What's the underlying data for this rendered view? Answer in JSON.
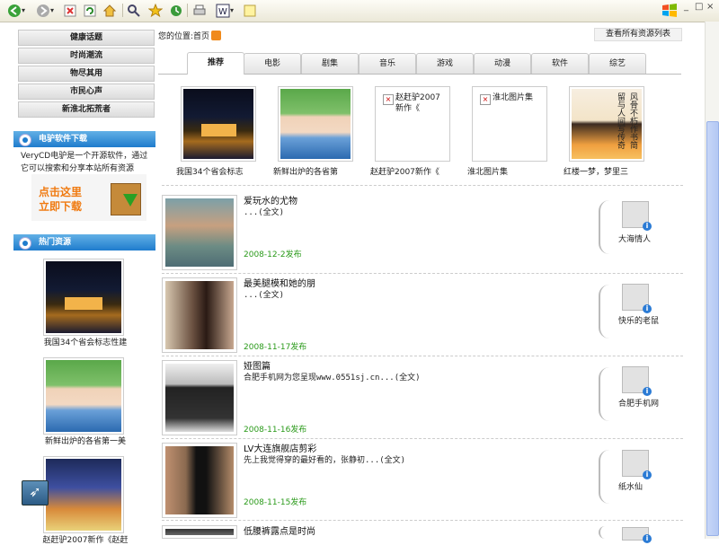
{
  "toolbar": {
    "icons": [
      "back-icon",
      "forward-icon",
      "stop-icon",
      "refresh-icon",
      "home-icon",
      "search-icon",
      "favorites-icon",
      "history-icon",
      "print-icon",
      "word-icon",
      "note-icon"
    ],
    "windows": [
      "_",
      "□",
      "×"
    ]
  },
  "sidebar": {
    "links": [
      "健康话题",
      "时尚潮流",
      "物尽其用",
      "市民心声",
      "新淮北拓荒者"
    ],
    "download_panel": {
      "title": "电驴软件下载",
      "desc": "VeryCD电驴是一个开源软件，通过它可以搜索和分享本站所有资源",
      "banner_line1": "点击这里",
      "banner_line2": "立即下载"
    },
    "hot_panel": {
      "title": "热门资源",
      "items": [
        "我国34个省会标志性建",
        "新鲜出炉的各省第一美",
        "赵赶驴2007新作《赵赶"
      ]
    }
  },
  "main": {
    "breadcrumb": "您的位置:首页",
    "view_all": "查看所有资源列表",
    "tabs": [
      "推荐",
      "电影",
      "剧集",
      "音乐",
      "游戏",
      "动漫",
      "软件",
      "综艺"
    ],
    "featured": [
      {
        "caption": "我国34个省会标志",
        "broken": false
      },
      {
        "caption": "新鲜出炉的各省第",
        "broken": false
      },
      {
        "caption": "赵赶驴2007新作《",
        "broken": true,
        "alt": "赵赶驴2007新作《"
      },
      {
        "caption": "淮北图片集",
        "broken": true,
        "alt": "淮北图片集"
      },
      {
        "caption": "红楼一梦，梦里三",
        "broken": false,
        "poster_text_1": "留与人间写传奇",
        "poster_text_2": "风骨不朽作书简"
      }
    ],
    "posts": [
      {
        "title": "爱玩水的尤物",
        "excerpt": "...(全文)",
        "date": "2008-12-2发布",
        "user": "大海情人"
      },
      {
        "title": "最美腿模和她的朋",
        "excerpt": "...(全文)",
        "date": "2008-11-17发布",
        "user": "快乐的老鼠"
      },
      {
        "title": "娅图篇",
        "excerpt": "合肥手机网为您呈现www.0551sj.cn...(全文)",
        "date": "2008-11-16发布",
        "user": "合肥手机网"
      },
      {
        "title": "LV大连旗舰店剪彩",
        "excerpt": "先上我觉得穿的最好看的，张静初...(全文)",
        "date": "2008-11-15发布",
        "user": "纸水仙"
      },
      {
        "title": "低腰裤露点是时尚",
        "excerpt": "",
        "date": "",
        "user": ""
      }
    ]
  },
  "colors": {
    "panel_head": "#1f7ccd",
    "date_green": "#2a9a1a",
    "banner_orange": "#f07a10"
  }
}
